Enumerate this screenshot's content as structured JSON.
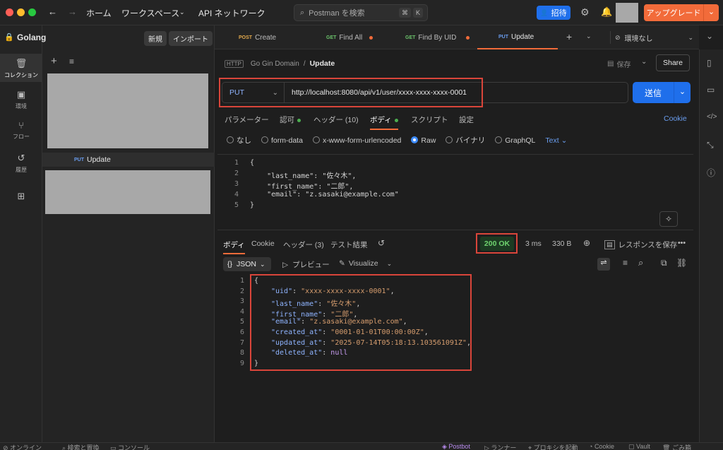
{
  "topbar": {
    "home": "ホーム",
    "workspaces": "ワークスペース",
    "api_network": "API ネットワーク",
    "search_placeholder": "Postman を検索",
    "kbd1": "⌘",
    "kbd2": "K",
    "invite": "招待",
    "upgrade": "アップグレード"
  },
  "rail": {
    "items": [
      {
        "label": "コレクション"
      },
      {
        "label": "環境"
      },
      {
        "label": "フロー"
      },
      {
        "label": "履歴"
      }
    ]
  },
  "sidebar": {
    "workspace": "Golang",
    "new_label": "新規",
    "import_label": "インポート",
    "request_method": "PUT",
    "request_name": "Update"
  },
  "tabs": [
    {
      "method": "POST",
      "name": "Create"
    },
    {
      "method": "GET",
      "name": "Find All"
    },
    {
      "method": "GET",
      "name": "Find By UID"
    },
    {
      "method": "PUT",
      "name": "Update"
    }
  ],
  "env_select": "環境なし",
  "breadcrumb": {
    "parent": "Go Gin Domain",
    "sep": "/",
    "current": "Update"
  },
  "save_label": "保存",
  "share_label": "Share",
  "request": {
    "method": "PUT",
    "url": "http://localhost:8080/api/v1/user/xxxx-xxxx-xxxx-0001",
    "send": "送信"
  },
  "req_tabs": {
    "params": "パラメーター",
    "auth": "認可",
    "headers": "ヘッダー (10)",
    "body": "ボディ",
    "script": "スクリプト",
    "settings": "設定",
    "cookie": "Cookie"
  },
  "body_types": {
    "none": "なし",
    "form_data": "form-data",
    "urlencoded": "x-www-form-urlencoded",
    "raw": "Raw",
    "binary": "バイナリ",
    "graphql": "GraphQL",
    "text": "Text"
  },
  "request_body": [
    "{",
    "    \"last_name\": \"佐々木\",",
    "    \"first_name\": \"二郎\",",
    "    \"email\": \"z.sasaki@example.com\"",
    "}"
  ],
  "response": {
    "tabs": {
      "body": "ボディ",
      "cookie": "Cookie",
      "headers": "ヘッダー (3)",
      "tests": "テスト結果"
    },
    "status": "200 OK",
    "time": "3 ms",
    "size": "330 B",
    "save_response": "レスポンスを保存",
    "format": "JSON",
    "preview": "プレビュー",
    "visualize": "Visualize"
  },
  "response_body": [
    {
      "text": "{",
      "type": "punc"
    },
    {
      "key": "\"uid\"",
      "val": "\"xxxx-xxxx-xxxx-0001\""
    },
    {
      "key": "\"last_name\"",
      "val": "\"佐々木\""
    },
    {
      "key": "\"first_name\"",
      "val": "\"二郎\""
    },
    {
      "key": "\"email\"",
      "val": "\"z.sasaki@example.com\""
    },
    {
      "key": "\"created_at\"",
      "val": "\"0001-01-01T00:00:00Z\""
    },
    {
      "key": "\"updated_at\"",
      "val": "\"2025-07-14T05:18:13.103561091Z\""
    },
    {
      "key": "\"deleted_at\"",
      "val": "null",
      "last": true
    },
    {
      "text": "}",
      "type": "punc"
    }
  ],
  "statusbar": {
    "online": "オンライン",
    "find_replace": "検索と置換",
    "console": "コンソール",
    "postbot": "Postbot",
    "runner": "ランナー",
    "proxy": "プロキシを起動",
    "cookies": "Cookie",
    "vault": "Vault",
    "trash": "ごみ箱"
  },
  "colors": {
    "accent": "#1f6feb",
    "upgrade": "#f26b3a",
    "highlight": "#d9453a",
    "ok": "#4caf50"
  }
}
